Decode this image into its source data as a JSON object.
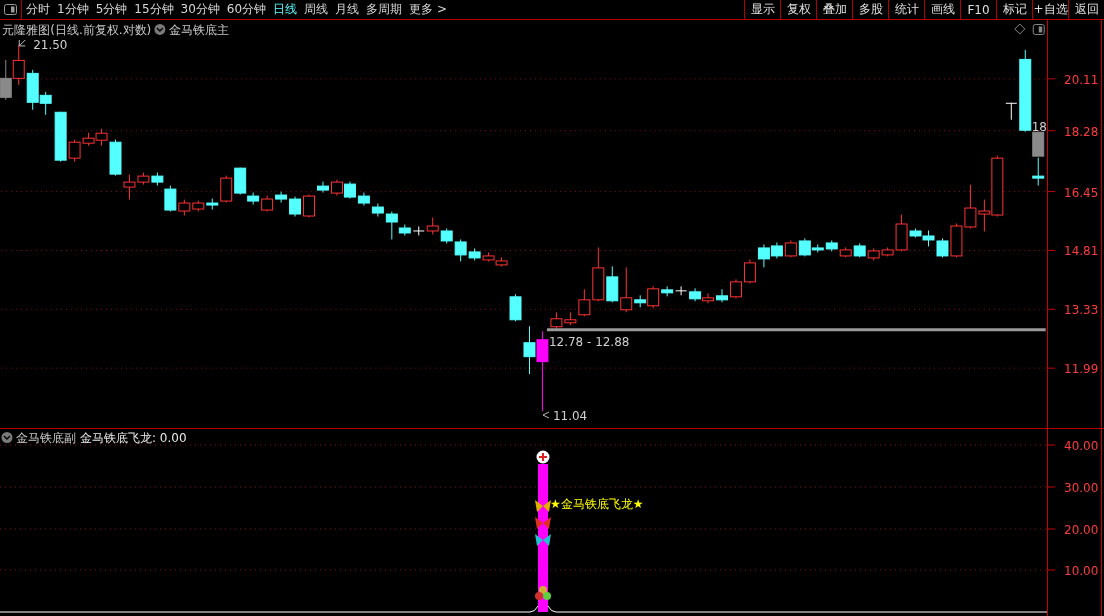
{
  "toolbar": {
    "periods": [
      {
        "label": "分时",
        "selected": false
      },
      {
        "label": "1分钟",
        "selected": false
      },
      {
        "label": "5分钟",
        "selected": false
      },
      {
        "label": "15分钟",
        "selected": false
      },
      {
        "label": "30分钟",
        "selected": false
      },
      {
        "label": "60分钟",
        "selected": false
      },
      {
        "label": "日线",
        "selected": true
      },
      {
        "label": "周线",
        "selected": false
      },
      {
        "label": "月线",
        "selected": false
      },
      {
        "label": "多周期",
        "selected": false
      },
      {
        "label": "更多 >",
        "selected": false
      }
    ],
    "buttons": [
      "显示",
      "复权",
      "叠加",
      "多股",
      "统计",
      "画线",
      "F10",
      "标记",
      "+自选",
      "返回"
    ]
  },
  "main_chart": {
    "title": "元隆雅图(日线.前复权.对数)",
    "indicator": "金马铁底主",
    "high_label": "21.50",
    "price_tag": "18",
    "range_label": "12.78 - 12.88",
    "low_label": "11.04",
    "y_axis": [
      "20.11",
      "18.28",
      "16.45",
      "14.81",
      "13.33",
      "11.99"
    ]
  },
  "sub_chart": {
    "indicator": "金马铁底副",
    "value_label": "金马铁底飞龙: 0.00",
    "signal_label": "★金马铁底飞龙★",
    "y_axis": [
      "40.00",
      "30.00",
      "20.00",
      "10.00"
    ]
  }
}
